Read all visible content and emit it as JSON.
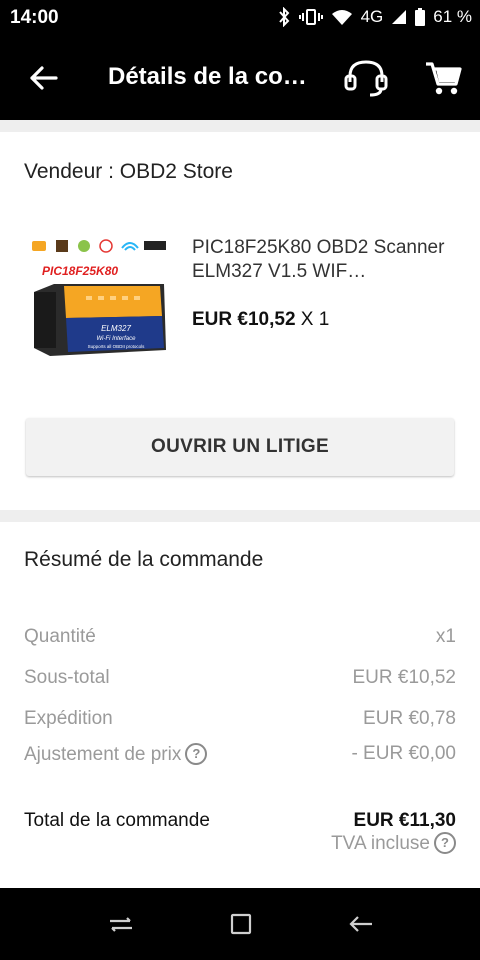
{
  "status_bar": {
    "time": "14:00",
    "network": "4G",
    "battery": "61 %"
  },
  "app_bar": {
    "title": "Détails de la co…"
  },
  "seller": {
    "label": "Vendeur : OBD2 Store"
  },
  "product": {
    "title": "PIC18F25K80 OBD2 Scanner ELM327 V1.5 WIF…",
    "price": "EUR €10,52",
    "quantity": "X 1",
    "image_caption": "PIC18F25K80",
    "device_brand": "ELM327",
    "device_sub": "Wi-Fi Interface",
    "device_support": "Supports all OBDII protocols"
  },
  "dispute_button": {
    "label": "OUVRIR UN LITIGE"
  },
  "summary": {
    "title": "Résumé de la commande",
    "rows": [
      {
        "label": "Quantité",
        "value": "x1"
      },
      {
        "label": "Sous-total",
        "value": "EUR €10,52"
      },
      {
        "label": "Expédition",
        "value": "EUR €0,78"
      },
      {
        "label": "Ajustement de prix",
        "value": "- EUR €0,00"
      }
    ],
    "total_label": "Total de la commande",
    "total_value": "EUR €11,30",
    "tax_note": "TVA incluse"
  },
  "colors": {
    "bars": "#000000",
    "divider": "#eeeeee",
    "muted_text": "#9a9a9a",
    "device_orange": "#f5a623",
    "device_blue": "#1f3a8a",
    "caption_red": "#e02020"
  }
}
